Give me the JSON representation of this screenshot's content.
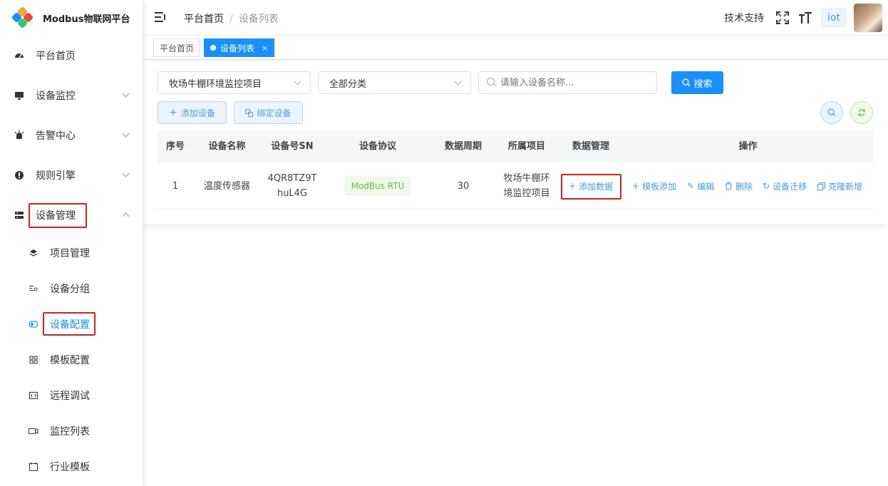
{
  "brand": {
    "title": "Modbus物联网平台"
  },
  "sidebar": {
    "items": [
      {
        "label": "平台首页",
        "icon": "dashboard-icon"
      },
      {
        "label": "设备监控",
        "icon": "monitor-icon"
      },
      {
        "label": "告警中心",
        "icon": "alarm-icon"
      },
      {
        "label": "规则引擎",
        "icon": "rule-icon"
      },
      {
        "label": "设备管理",
        "icon": "server-icon"
      }
    ],
    "sub_items": [
      {
        "label": "项目管理",
        "icon": "layers-icon"
      },
      {
        "label": "设备分组",
        "icon": "group-icon"
      },
      {
        "label": "设备配置",
        "icon": "toggle-icon"
      },
      {
        "label": "模板配置",
        "icon": "grid-icon"
      },
      {
        "label": "远程调试",
        "icon": "code-icon"
      },
      {
        "label": "监控列表",
        "icon": "camera-icon"
      },
      {
        "label": "行业模板",
        "icon": "calendar-icon"
      }
    ]
  },
  "header": {
    "breadcrumb_home": "平台首页",
    "breadcrumb_sep": "/",
    "breadcrumb_current": "设备列表",
    "support_link": "技术支持",
    "user_tag": "iot"
  },
  "tags": {
    "home": "平台首页",
    "active": "设备列表",
    "close": "×"
  },
  "filters": {
    "project_select": "牧场牛棚环境监控项目",
    "category_select": "全部分类",
    "search_placeholder": "请输入设备名称...",
    "search_button": "搜索",
    "add_device": "添加设备",
    "bind_device": "绑定设备"
  },
  "table": {
    "headers": [
      "序号",
      "设备名称",
      "设备号SN",
      "设备协议",
      "数据周期",
      "所属项目",
      "数据管理",
      "操作"
    ],
    "rows": [
      {
        "index": "1",
        "name": "温度传感器",
        "sn_line1": "4QR8TZ9T",
        "sn_line2": "huL4G",
        "protocol": "ModBus RTU",
        "period": "30",
        "project_line1": "牧场牛棚环",
        "project_line2": "境监控项目",
        "add_data": "添加数据",
        "ops": {
          "template_add": "模板添加",
          "edit": "编辑",
          "delete": "删除",
          "migrate": "设备迁移",
          "clone": "克隆新增"
        }
      }
    ]
  },
  "colors": {
    "primary": "#1890ff",
    "highlight": "#e02020",
    "protocol_green": "#67c23a"
  }
}
